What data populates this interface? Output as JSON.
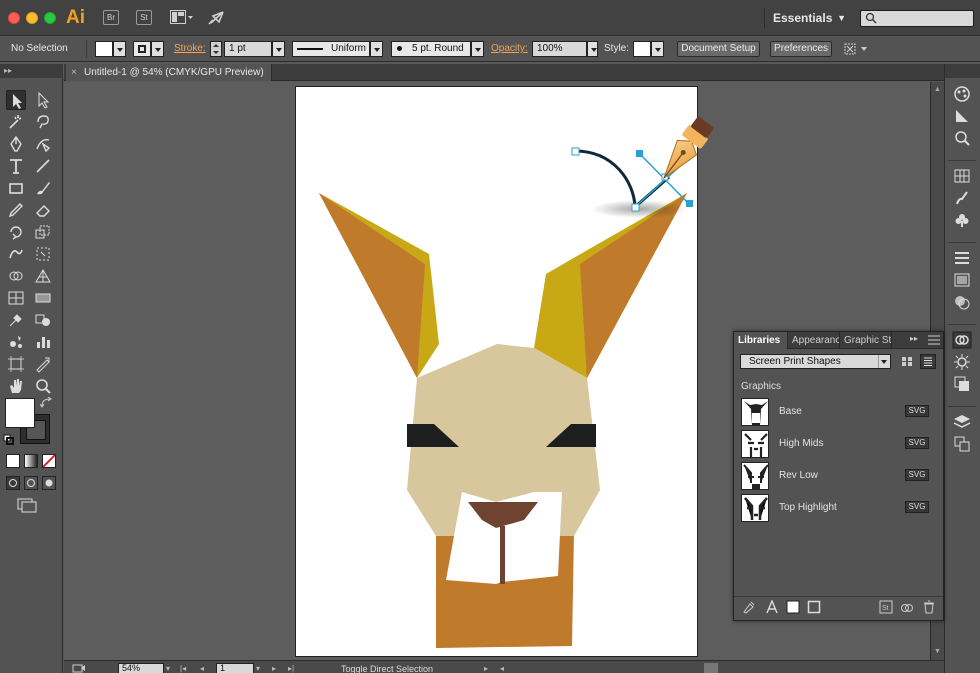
{
  "app": {
    "logo": "Ai",
    "bridge_label": "Br",
    "stock_label": "St",
    "workspace": "Essentials",
    "search_placeholder": ""
  },
  "control_bar": {
    "selection_status": "No Selection",
    "stroke_label": "Stroke:",
    "stroke_weight": "1 pt",
    "stroke_profile": "Uniform",
    "brush": "5 pt. Round",
    "opacity_label": "Opacity:",
    "opacity_value": "100%",
    "style_label": "Style:",
    "document_setup": "Document Setup",
    "preferences": "Preferences"
  },
  "document": {
    "tab_title": "Untitled-1 @ 54% (CMYK/GPU Preview)",
    "close_glyph": "×"
  },
  "libraries_panel": {
    "tabs": [
      "Libraries",
      "Appearance",
      "Graphic Styles"
    ],
    "collapse_glyph": "▸▸",
    "library_name": "Screen Print Shapes",
    "section": "Graphics",
    "items": [
      {
        "name": "Base",
        "badge": "SVG"
      },
      {
        "name": "High Mids",
        "badge": "SVG"
      },
      {
        "name": "Rev Low",
        "badge": "SVG"
      },
      {
        "name": "Top Highlight",
        "badge": "SVG"
      }
    ]
  },
  "status_bar": {
    "zoom": "54%",
    "artboard_number": "1",
    "status_text": "Toggle Direct Selection"
  },
  "colors": {
    "ui_panel": "#535353",
    "ui_dark": "#3c3c3c",
    "canvas": "#5d5d5d",
    "accent_orange": "#f1a35a",
    "logo_orange": "#f3a11a",
    "llama_ear_outer": "#c8a814",
    "llama_ear_inner": "#c07a2c",
    "llama_face": "#d8c79d",
    "llama_neck": "#c07a2c",
    "llama_eye": "#1c1f1d",
    "llama_nose": "#6e4330",
    "pen_path": "#0e2a3a",
    "handle": "#2aa1d0"
  },
  "icons": {
    "tools": [
      "selection-tool-icon",
      "direct-selection-tool-icon",
      "magic-wand-tool-icon",
      "lasso-tool-icon",
      "pen-tool-icon",
      "curvature-tool-icon",
      "type-tool-icon",
      "line-segment-tool-icon",
      "rectangle-tool-icon",
      "paintbrush-tool-icon",
      "pencil-tool-icon",
      "eraser-tool-icon",
      "rotate-tool-icon",
      "scale-tool-icon",
      "warp-tool-icon",
      "free-transform-tool-icon",
      "shape-builder-tool-icon",
      "perspective-grid-tool-icon",
      "mesh-tool-icon",
      "gradient-tool-icon",
      "eyedropper-tool-icon",
      "blend-tool-icon",
      "symbol-sprayer-tool-icon",
      "column-graph-tool-icon",
      "artboard-tool-icon",
      "slice-tool-icon",
      "hand-tool-icon",
      "zoom-tool-icon"
    ]
  }
}
